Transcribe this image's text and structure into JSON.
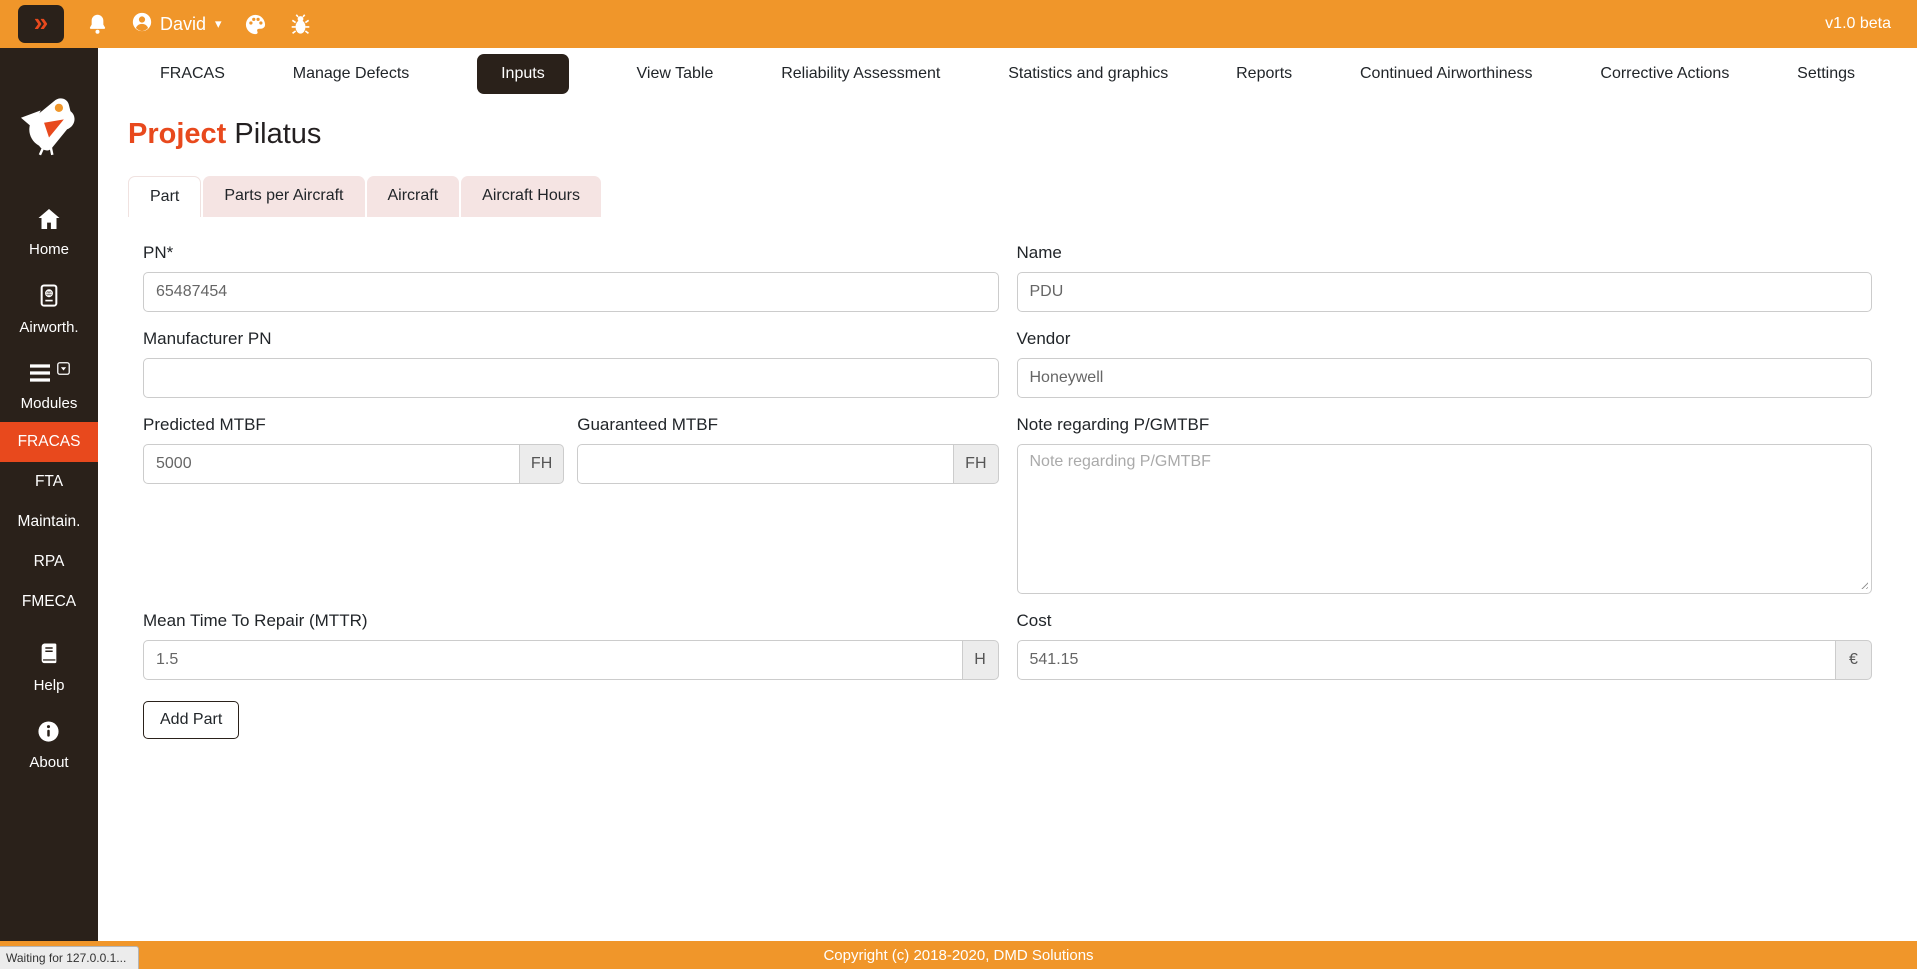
{
  "colors": {
    "orange": "#F0962A",
    "dark": "#2A211A",
    "accent": "#E8491D",
    "tab_pink": "#F5E4E3"
  },
  "topbar": {
    "menu_glyph": "»",
    "user_name": "David",
    "caret_glyph": "▾",
    "version": "v1.0 beta"
  },
  "sidebar": {
    "home_label": "Home",
    "airworthiness_label": "Airworth.",
    "modules_label": "Modules",
    "modules": [
      {
        "label": "FRACAS",
        "active": true
      },
      {
        "label": "FTA",
        "active": false
      },
      {
        "label": "Maintain.",
        "active": false
      },
      {
        "label": "RPA",
        "active": false
      },
      {
        "label": "FMECA",
        "active": false
      }
    ],
    "help_label": "Help",
    "about_label": "About"
  },
  "nav": {
    "items": [
      {
        "label": "FRACAS",
        "active": false
      },
      {
        "label": "Manage Defects",
        "active": false
      },
      {
        "label": "Inputs",
        "active": true
      },
      {
        "label": "View Table",
        "active": false
      },
      {
        "label": "Reliability Assessment",
        "active": false
      },
      {
        "label": "Statistics and graphics",
        "active": false
      },
      {
        "label": "Reports",
        "active": false
      },
      {
        "label": "Continued Airworthiness",
        "active": false
      },
      {
        "label": "Corrective Actions",
        "active": false
      },
      {
        "label": "Settings",
        "active": false
      }
    ]
  },
  "page": {
    "title_accent": "Project",
    "title_name": "Pilatus"
  },
  "tabs": [
    {
      "label": "Part",
      "active": true
    },
    {
      "label": "Parts per Aircraft",
      "active": false
    },
    {
      "label": "Aircraft",
      "active": false
    },
    {
      "label": "Aircraft Hours",
      "active": false
    }
  ],
  "form": {
    "pn": {
      "label": "PN*",
      "value": "65487454"
    },
    "name": {
      "label": "Name",
      "value": "PDU"
    },
    "manufacturer_pn": {
      "label": "Manufacturer PN",
      "value": ""
    },
    "vendor": {
      "label": "Vendor",
      "value": "Honeywell"
    },
    "predicted_mtbf": {
      "label": "Predicted MTBF",
      "value": "5000",
      "unit": "FH"
    },
    "guaranteed_mtbf": {
      "label": "Guaranteed MTBF",
      "value": "",
      "unit": "FH"
    },
    "note": {
      "label": "Note regarding P/GMTBF",
      "value": "",
      "placeholder": "Note regarding P/GMTBF"
    },
    "mttr": {
      "label": "Mean Time To Repair (MTTR)",
      "value": "1.5",
      "unit": "H"
    },
    "cost": {
      "label": "Cost",
      "value": "541.15",
      "unit": "€"
    },
    "add_part_label": "Add Part"
  },
  "footer": {
    "copyright": "Copyright (c) 2018-2020, DMD Solutions",
    "status": "Waiting for 127.0.0.1..."
  }
}
